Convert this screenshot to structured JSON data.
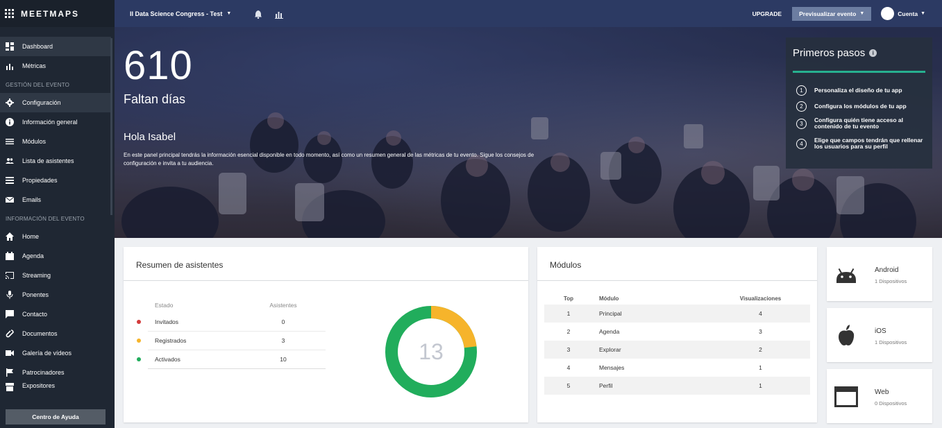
{
  "app": {
    "brand": "MEETMAPS"
  },
  "topbar": {
    "event_name": "II Data Science Congress - Test",
    "upgrade": "UPGRADE",
    "preview": "Previsualizar evento",
    "account": "Cuenta"
  },
  "sidebar": {
    "top_items": [
      {
        "label": "Dashboard",
        "icon": "dashboard-icon"
      },
      {
        "label": "Métricas",
        "icon": "bar-chart-icon"
      }
    ],
    "section1": "GESTIÓN DEL EVENTO",
    "mgmt_items": [
      {
        "label": "Configuración",
        "icon": "gear-icon"
      },
      {
        "label": "Información general",
        "icon": "info-icon"
      },
      {
        "label": "Módulos",
        "icon": "menu-icon"
      },
      {
        "label": "Lista de asistentes",
        "icon": "people-icon"
      },
      {
        "label": "Propiedades",
        "icon": "list-icon"
      },
      {
        "label": "Emails",
        "icon": "mail-icon"
      }
    ],
    "section2": "INFORMACIÓN DEL EVENTO",
    "info_items": [
      {
        "label": "Home",
        "icon": "home-icon"
      },
      {
        "label": "Agenda",
        "icon": "calendar-icon"
      },
      {
        "label": "Streaming",
        "icon": "cast-icon"
      },
      {
        "label": "Ponentes",
        "icon": "mic-icon"
      },
      {
        "label": "Contacto",
        "icon": "chat-icon"
      },
      {
        "label": "Documentos",
        "icon": "paperclip-icon"
      },
      {
        "label": "Galería de vídeos",
        "icon": "video-icon"
      },
      {
        "label": "Patrocinadores",
        "icon": "flag-icon"
      },
      {
        "label": "Expositores",
        "icon": "store-icon"
      }
    ],
    "help": "Centro de Ayuda"
  },
  "hero": {
    "days": "610",
    "days_label": "Faltan días",
    "greeting": "Hola Isabel",
    "intro": "En este panel principal tendrás la información esencial disponible en todo momento, así como un resumen general de las métricas de tu evento. Sigue los consejos de configuración e invita a tu audiencia."
  },
  "steps": {
    "title": "Primeros pasos",
    "items": [
      {
        "n": "1",
        "text": "Personaliza el diseño de tu app"
      },
      {
        "n": "2",
        "text": "Configura los módulos de tu app"
      },
      {
        "n": "3",
        "text": "Configura quién tiene acceso al contenido de tu evento"
      },
      {
        "n": "4",
        "text": "Elige que campos tendrán que rellenar los usuarios para su perfil"
      }
    ]
  },
  "attendees": {
    "title": "Resumen de asistentes",
    "col_state": "Estado",
    "col_count": "Asistentes",
    "rows": [
      {
        "state": "Invitados",
        "count": "0",
        "color": "#d33b3b"
      },
      {
        "state": "Registrados",
        "count": "3",
        "color": "#f6b42b"
      },
      {
        "state": "Activados",
        "count": "10",
        "color": "#21ad5c"
      }
    ],
    "total": "13"
  },
  "modules": {
    "title": "Módulos",
    "col_top": "Top",
    "col_module": "Módulo",
    "col_views": "Visualizaciones",
    "rows": [
      {
        "top": "1",
        "module": "Principal",
        "views": "4"
      },
      {
        "top": "2",
        "module": "Agenda",
        "views": "3"
      },
      {
        "top": "3",
        "module": "Explorar",
        "views": "2"
      },
      {
        "top": "4",
        "module": "Mensajes",
        "views": "1"
      },
      {
        "top": "5",
        "module": "Perfil",
        "views": "1"
      }
    ]
  },
  "devices": [
    {
      "name": "Android",
      "count": "1 Dispositivos",
      "icon": "android-icon"
    },
    {
      "name": "iOS",
      "count": "1 Dispositivos",
      "icon": "apple-icon"
    },
    {
      "name": "Web",
      "count": "0 Dispositivos",
      "icon": "browser-window-icon"
    }
  ]
}
